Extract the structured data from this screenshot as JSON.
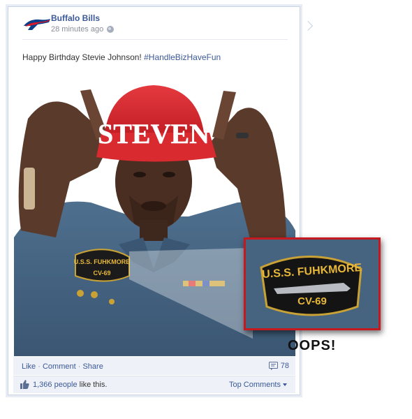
{
  "post": {
    "page_name": "Buffalo Bills",
    "timestamp": "28 minutes ago",
    "privacy_icon": "globe-icon",
    "message_text": "Happy Birthday Stevie Johnson! ",
    "hashtag": "#HandleBizHaveFun"
  },
  "photo": {
    "cap_text": "STEVEN",
    "patch_line1": "U.S.S. FUHKMORE",
    "patch_line2": "CV-69"
  },
  "inset": {
    "patch_line1": "U.S.S. FUHKMORE",
    "patch_line2": "CV-69",
    "border_color": "#c41a1f"
  },
  "annotation": {
    "oops": "OOPS!"
  },
  "actions": {
    "like": "Like",
    "comment": "Comment",
    "share": "Share",
    "separator": "·",
    "comment_count": "78"
  },
  "likes": {
    "count": "1,366 people",
    "suffix": " like this.",
    "top_comments": "Top Comments"
  },
  "colors": {
    "link": "#3b5998",
    "bar_bg": "#eef1f7"
  }
}
